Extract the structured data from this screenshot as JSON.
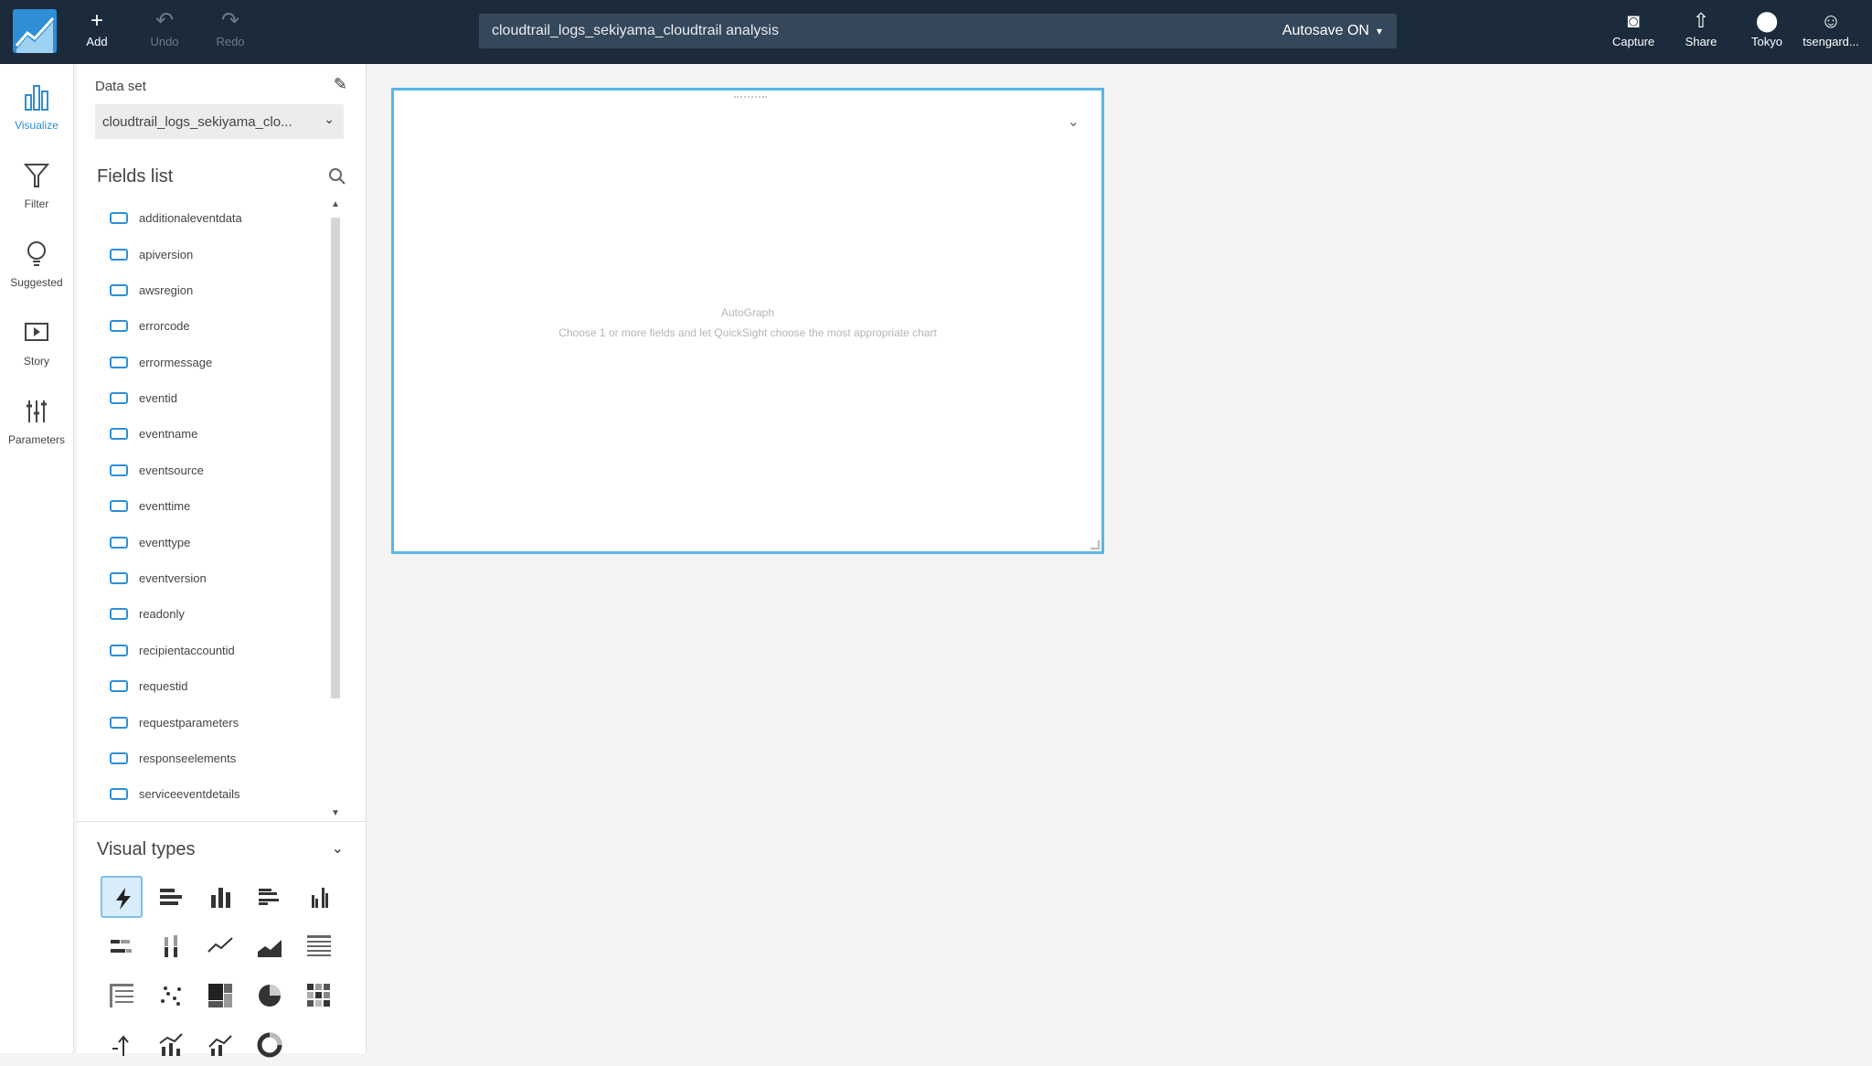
{
  "topbar": {
    "add": "Add",
    "undo": "Undo",
    "redo": "Redo",
    "title": "cloudtrail_logs_sekiyama_cloudtrail analysis",
    "autosave": "Autosave ON",
    "capture": "Capture",
    "share": "Share",
    "region": "Tokyo",
    "user": "tsengard..."
  },
  "rail": {
    "visualize": "Visualize",
    "filter": "Filter",
    "suggested": "Suggested",
    "story": "Story",
    "parameters": "Parameters"
  },
  "dataset": {
    "label": "Data set",
    "selected": "cloudtrail_logs_sekiyama_clo..."
  },
  "fields_list": {
    "title": "Fields list",
    "fields": [
      "additionaleventdata",
      "apiversion",
      "awsregion",
      "errorcode",
      "errormessage",
      "eventid",
      "eventname",
      "eventsource",
      "eventtime",
      "eventtype",
      "eventversion",
      "readonly",
      "recipientaccountid",
      "requestid",
      "requestparameters",
      "responseelements",
      "serviceeventdetails"
    ]
  },
  "visual_types": {
    "title": "Visual types",
    "icons": [
      "autograph-icon",
      "horizontal-bar-icon",
      "vertical-bar-icon",
      "clustered-horizontal-bar-icon",
      "clustered-vertical-bar-icon",
      "stacked-horizontal-bar-icon",
      "stacked-vertical-bar-icon",
      "line-chart-icon",
      "area-chart-icon",
      "table-icon",
      "pivot-table-icon",
      "scatter-plot-icon",
      "tree-map-icon",
      "pie-chart-icon",
      "heat-map-icon",
      "kpi-icon",
      "combo-chart-icon",
      "combo-line-icon",
      "donut-chart-icon"
    ]
  },
  "visual": {
    "autograph_title": "AutoGraph",
    "autograph_desc": "Choose 1 or more fields and let QuickSight choose the most appropriate chart"
  },
  "colors": {
    "topbar": "#1b2b3c",
    "accent": "#2e8fd6",
    "visual_border": "#5ab5e8"
  }
}
